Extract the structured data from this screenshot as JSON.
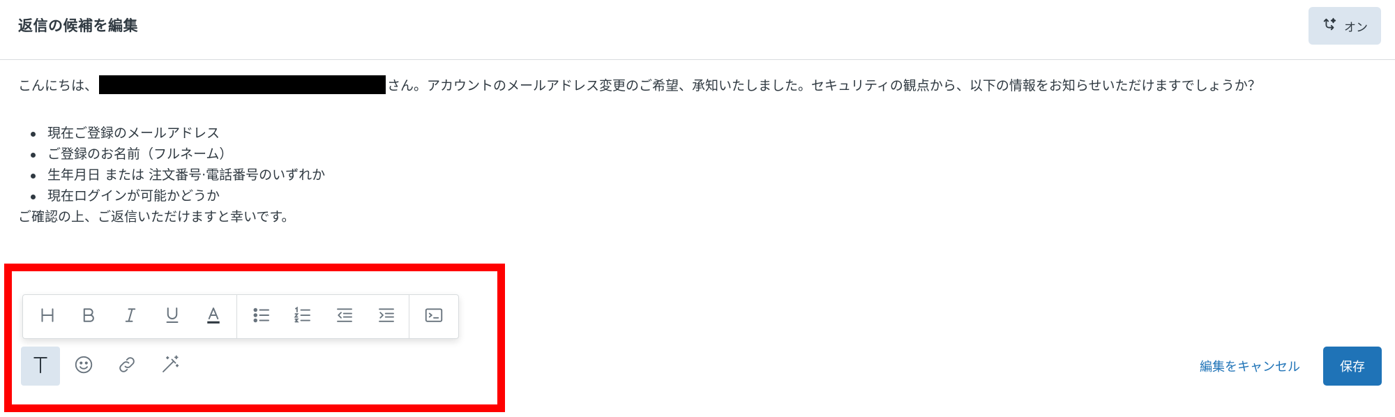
{
  "header": {
    "title": "返信の候補を編集",
    "toggle_label": "オン"
  },
  "message": {
    "greeting_prefix": "こんにちは、",
    "greeting_suffix": "さん。アカウントのメールアドレス変更のご希望、承知いたしました。セキュリティの観点から、以下の情報をお知らせいただけますでしょうか？",
    "bullets": [
      "現在ご登録のメールアドレス",
      "ご登録のお名前（フルネーム）",
      "生年月日 または 注文番号·電話番号のいずれか",
      "現在ログインが可能かどうか"
    ],
    "closing": "ご確認の上、ご返信いただけますと幸いです。"
  },
  "toolbar": {
    "icons": [
      "heading-icon",
      "bold-icon",
      "italic-icon",
      "underline-icon",
      "text-color-icon",
      "bulleted-list-icon",
      "numbered-list-icon",
      "outdent-icon",
      "indent-icon",
      "code-block-icon"
    ]
  },
  "tools": {
    "icons": [
      "text-format-icon",
      "emoji-icon",
      "link-icon",
      "magic-wand-icon"
    ]
  },
  "footer": {
    "cancel_label": "編集をキャンセル",
    "save_label": "保存"
  },
  "colors": {
    "accent": "#1f73b7",
    "highlight": "#ff0000",
    "toggle_bg": "#dbe5ef",
    "text": "#2f3941",
    "icon": "#68737d"
  }
}
